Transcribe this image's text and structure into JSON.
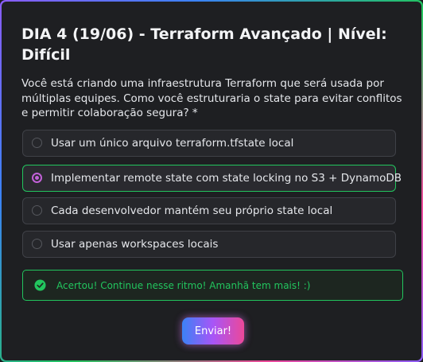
{
  "quiz": {
    "title": "DIA 4 (19/06) - Terraform Avançado | Nível: Difícil",
    "question": "Você está criando uma infraestrutura Terraform que será usada por múltiplas equipes. Como você estruturaria o state para evitar conflitos e permitir colaboração segura? *",
    "options": [
      {
        "label": "Usar um único arquivo terraform.tfstate local",
        "selected": false
      },
      {
        "label": "Implementar remote state com state locking no S3 + DynamoDB",
        "selected": true
      },
      {
        "label": "Cada desenvolvedor mantém seu próprio state local",
        "selected": false
      },
      {
        "label": "Usar apenas workspaces locais",
        "selected": false
      }
    ],
    "feedback": {
      "icon": "check-circle-icon",
      "text": "Acertou! Continue nesse ritmo! Amanhã tem mais! :)"
    },
    "submit_label": "Enviar!"
  },
  "colors": {
    "background": "#1e1f22",
    "success": "#22c55e",
    "radio_selected": "#c261d8",
    "button_gradient": [
      "#3b82f6",
      "#a855f7",
      "#ec4899"
    ]
  }
}
